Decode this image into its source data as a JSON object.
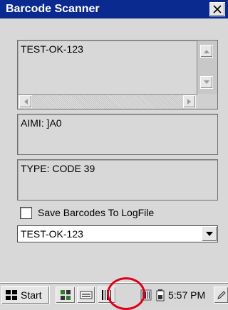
{
  "window": {
    "title": "Barcode Scanner"
  },
  "barcode_text": "TEST-OK-123",
  "aimi_text": "AIMI: ]A0",
  "type_text": "TYPE: CODE 39",
  "save_checkbox": {
    "label": "Save Barcodes To LogFile",
    "checked": false
  },
  "history_combo": {
    "value": "TEST-OK-123"
  },
  "taskbar": {
    "start_label": "Start",
    "clock": "5:57 PM"
  },
  "colors": {
    "titlebar": "#0b2a8f",
    "highlight": "#e0001a"
  }
}
